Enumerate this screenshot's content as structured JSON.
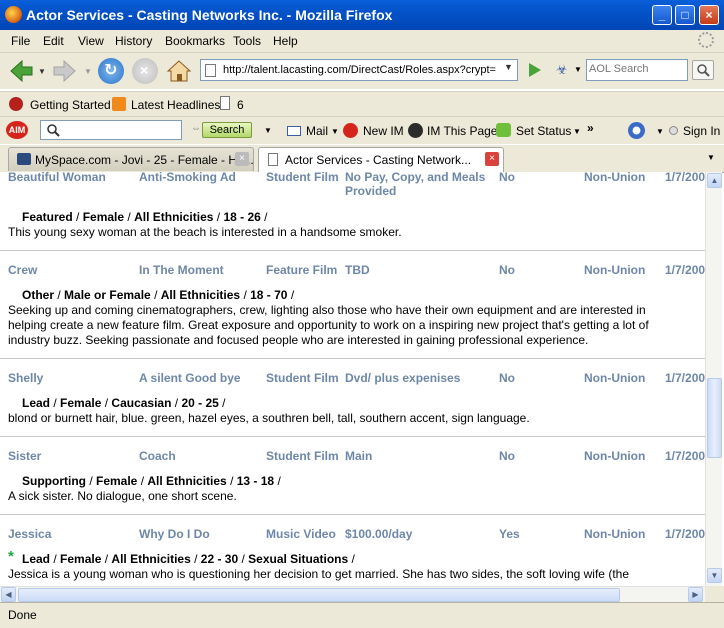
{
  "window": {
    "title": "Actor Services - Casting Networks Inc. - Mozilla Firefox",
    "min": "_",
    "max": "□",
    "close": "×"
  },
  "menu": [
    "File",
    "Edit",
    "View",
    "History",
    "Bookmarks",
    "Tools",
    "Help"
  ],
  "nav": {
    "url": "http://talent.lacasting.com/DirectCast/Roles.aspx?crypt=",
    "search_placeholder": "AOL Search"
  },
  "bookmarks": {
    "getting_started": "Getting Started",
    "latest_headlines": "Latest Headlines",
    "count": "6"
  },
  "aim": {
    "aim_label": "AIM",
    "search_button": "Search",
    "mail": "Mail",
    "new_im": "New IM",
    "im_this_page": "IM This Page",
    "set_status": "Set Status",
    "more": "»",
    "sign_in": "Sign In"
  },
  "tabs": [
    {
      "label": "MySpace.com - Jovi - 25 - Female - Ha...",
      "active": false
    },
    {
      "label": "Actor Services - Casting Network...",
      "active": true
    }
  ],
  "roles": [
    {
      "name": "Beautiful Woman",
      "project": "Anti-Smoking Ad",
      "type": "Student Film",
      "pay": "No Pay, Copy, and Meals",
      "pay2": "Provided",
      "selected": "No",
      "union": "Non-Union",
      "date": "1/7/200",
      "rtype": "Featured",
      "gender": "Female",
      "ethnicity": "All Ethnicities",
      "ages": "18 - 26",
      "extra": "",
      "description": "This young sexy woman at the beach is interested in a handsome smoker."
    },
    {
      "name": "Crew",
      "project": "In The Moment",
      "type": "Feature Film",
      "pay": "TBD",
      "pay2": "",
      "selected": "No",
      "union": "Non-Union",
      "date": "1/7/200",
      "rtype": "Other",
      "gender": "Male or Female",
      "ethnicity": "All Ethnicities",
      "ages": "18 - 70",
      "extra": "",
      "description": "Seeking up and coming cinematographers, crew, lighting also those who have their own equipment and are interested in helping create a new feature film. Great exposure and opportunity to work on a inspiring new project that's getting a lot of industry buzz. Seeking passionate and focused people who are interested in gaining professional experience."
    },
    {
      "name": "Shelly",
      "project": "A silent Good bye",
      "type": "Student Film",
      "pay": "Dvd/ plus expenises",
      "pay2": "",
      "selected": "No",
      "union": "Non-Union",
      "date": "1/7/200",
      "rtype": "Lead",
      "gender": "Female",
      "ethnicity": "Caucasian",
      "ages": "20 - 25",
      "extra": "",
      "description": "blond or burnett hair, blue. green, hazel eyes, a southren bell, tall, southern accent, sign language."
    },
    {
      "name": "Sister",
      "project": "Coach",
      "type": "Student Film",
      "pay": "Main",
      "pay2": "",
      "selected": "No",
      "union": "Non-Union",
      "date": "1/7/200",
      "rtype": "Supporting",
      "gender": "Female",
      "ethnicity": "All Ethnicities",
      "ages": "13 - 18",
      "extra": "",
      "description": "A sick sister. No dialogue, one short scene."
    },
    {
      "name": "Jessica",
      "project": "Why Do I Do",
      "type": "Music Video",
      "pay": "$100.00/day",
      "pay2": "",
      "selected": "Yes",
      "union": "Non-Union",
      "date": "1/7/200",
      "rtype": "Lead",
      "gender": "Female",
      "ethnicity": "All Ethnicities",
      "ages": "22 - 30",
      "extra": "Sexual Situations",
      "description": "Jessica is a young woman who is questioning her decision to get married. She has two sides, the soft loving wife (the"
    }
  ],
  "status": "Done"
}
